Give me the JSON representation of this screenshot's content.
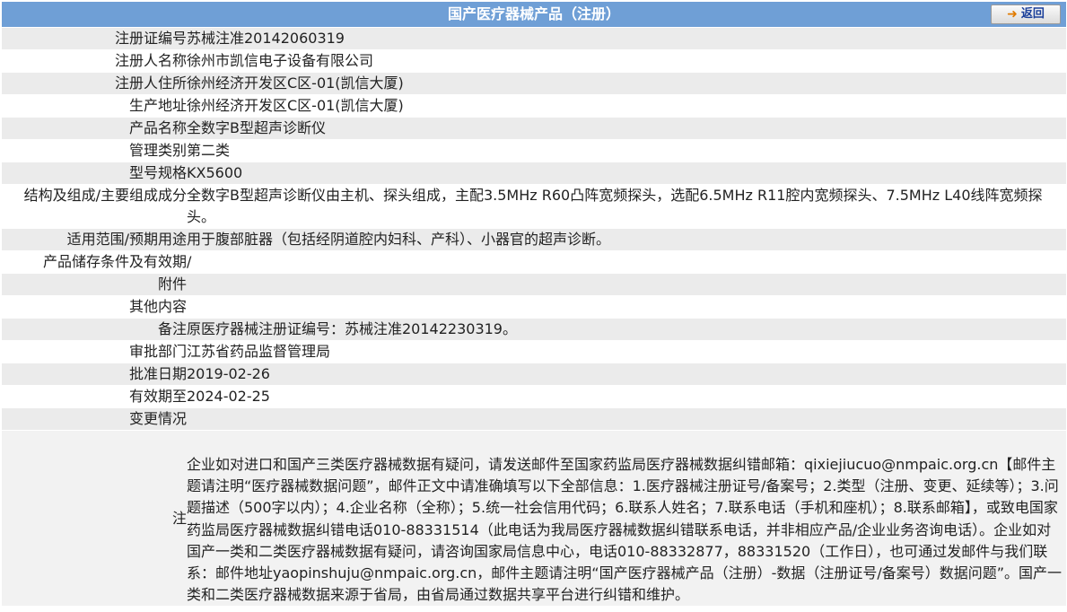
{
  "header": {
    "title": "国产医疗器械产品（注册）",
    "back_label": "返回"
  },
  "rows": [
    {
      "label": "注册证编号",
      "value": "苏械注准20142060319"
    },
    {
      "label": "注册人名称",
      "value": "徐州市凯信电子设备有限公司"
    },
    {
      "label": "注册人住所",
      "value": "徐州经济开发区C区-01(凯信大厦)"
    },
    {
      "label": "生产地址",
      "value": "徐州经济开发区C区-01(凯信大厦)"
    },
    {
      "label": "产品名称",
      "value": "全数字B型超声诊断仪"
    },
    {
      "label": "管理类别",
      "value": "第二类"
    },
    {
      "label": "型号规格",
      "value": "KX5600"
    },
    {
      "label": "结构及组成/主要组成成分",
      "value": "全数字B型超声诊断仪由主机、探头组成，主配3.5MHz R60凸阵宽频探头，选配6.5MHz R11腔内宽频探头、7.5MHz L40线阵宽频探头。"
    },
    {
      "label": "适用范围/预期用途",
      "value": "用于腹部脏器（包括经阴道腔内妇科、产科）、小器官的超声诊断。"
    },
    {
      "label": "产品储存条件及有效期",
      "value": "/"
    },
    {
      "label": "附件",
      "value": ""
    },
    {
      "label": "其他内容",
      "value": ""
    },
    {
      "label": "备注",
      "value": "原医疗器械注册证编号：苏械注准20142230319。"
    },
    {
      "label": "审批部门",
      "value": "江苏省药品监督管理局"
    },
    {
      "label": "批准日期",
      "value": "2019-02-26"
    },
    {
      "label": "有效期至",
      "value": "2024-02-25"
    },
    {
      "label": "变更情况",
      "value": ""
    }
  ],
  "note": {
    "label": "注",
    "text": "企业如对进口和国产三类医疗器械数据有疑问，请发送邮件至国家药监局医疗器械数据纠错邮箱：qixiejiucuo@nmpaic.org.cn【邮件主题请注明“医疗器械数据问题”，邮件正文中请准确填写以下全部信息：1.医疗器械注册证号/备案号；2.类型（注册、变更、延续等）；3.问题描述（500字以内）；4.企业名称（全称）；5.统一社会信用代码；6.联系人姓名；7.联系电话（手机和座机）；8.联系邮箱】，或致电国家药监局医疗器械数据纠错电话010-88331514（此电话为我局医疗器械数据纠错联系电话，并非相应产品/企业业务咨询电话）。企业如对国产一类和二类医疗器械数据有疑问，请咨询国家局信息中心，电话010-88332877，88331520（工作日），也可通过发邮件与我们联系：邮件地址yaopinshuju@nmpaic.org.cn，邮件主题请注明“国产医疗器械产品（注册）-数据（注册证号/备案号）数据问题”。国产一类和二类医疗器械数据来源于省局，由省局通过数据共享平台进行纠错和维护。"
  }
}
